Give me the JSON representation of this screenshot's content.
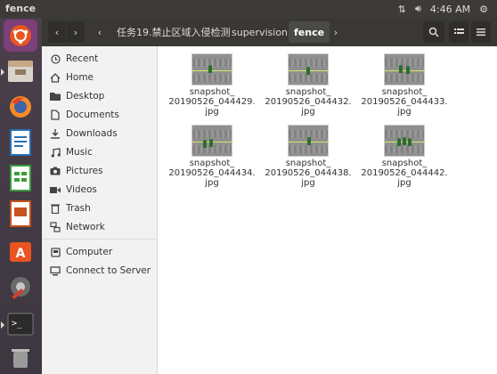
{
  "topbar": {
    "app_title": "fence",
    "clock": "4:46 AM",
    "icons": [
      "network-arrows-icon",
      "volume-icon",
      "settings-gear-icon"
    ]
  },
  "launcher": {
    "items": [
      {
        "name": "ubuntu-dash-icon"
      },
      {
        "name": "files-icon"
      },
      {
        "name": "firefox-icon"
      },
      {
        "name": "writer-icon"
      },
      {
        "name": "calc-icon"
      },
      {
        "name": "impress-icon"
      },
      {
        "name": "software-center-icon"
      },
      {
        "name": "system-settings-icon"
      },
      {
        "name": "terminal-icon"
      },
      {
        "name": "trash-icon"
      }
    ]
  },
  "header": {
    "breadcrumbs": [
      "任务19.禁止区域入侵检测",
      "supervision",
      "fence"
    ],
    "active_crumb": "fence"
  },
  "sidebar": {
    "places": [
      {
        "label": "Recent",
        "icon": "clock-icon"
      },
      {
        "label": "Home",
        "icon": "home-icon"
      },
      {
        "label": "Desktop",
        "icon": "folder-icon"
      },
      {
        "label": "Documents",
        "icon": "document-icon"
      },
      {
        "label": "Downloads",
        "icon": "download-icon"
      },
      {
        "label": "Music",
        "icon": "music-icon"
      },
      {
        "label": "Pictures",
        "icon": "camera-icon"
      },
      {
        "label": "Videos",
        "icon": "video-icon"
      },
      {
        "label": "Trash",
        "icon": "trash-icon"
      },
      {
        "label": "Network",
        "icon": "network-icon"
      }
    ],
    "devices": [
      {
        "label": "Computer",
        "icon": "computer-icon"
      },
      {
        "label": "Connect to Server",
        "icon": "server-icon"
      }
    ]
  },
  "files": [
    {
      "line1": "snapshot_",
      "line2": "20190526_044429.",
      "line3": "jpg"
    },
    {
      "line1": "snapshot_",
      "line2": "20190526_044432.",
      "line3": "jpg"
    },
    {
      "line1": "snapshot_",
      "line2": "20190526_044433.",
      "line3": "jpg"
    },
    {
      "line1": "snapshot_",
      "line2": "20190526_044434.",
      "line3": "jpg"
    },
    {
      "line1": "snapshot_",
      "line2": "20190526_044438.",
      "line3": "jpg"
    },
    {
      "line1": "snapshot_",
      "line2": "20190526_044442.",
      "line3": "jpg"
    }
  ]
}
